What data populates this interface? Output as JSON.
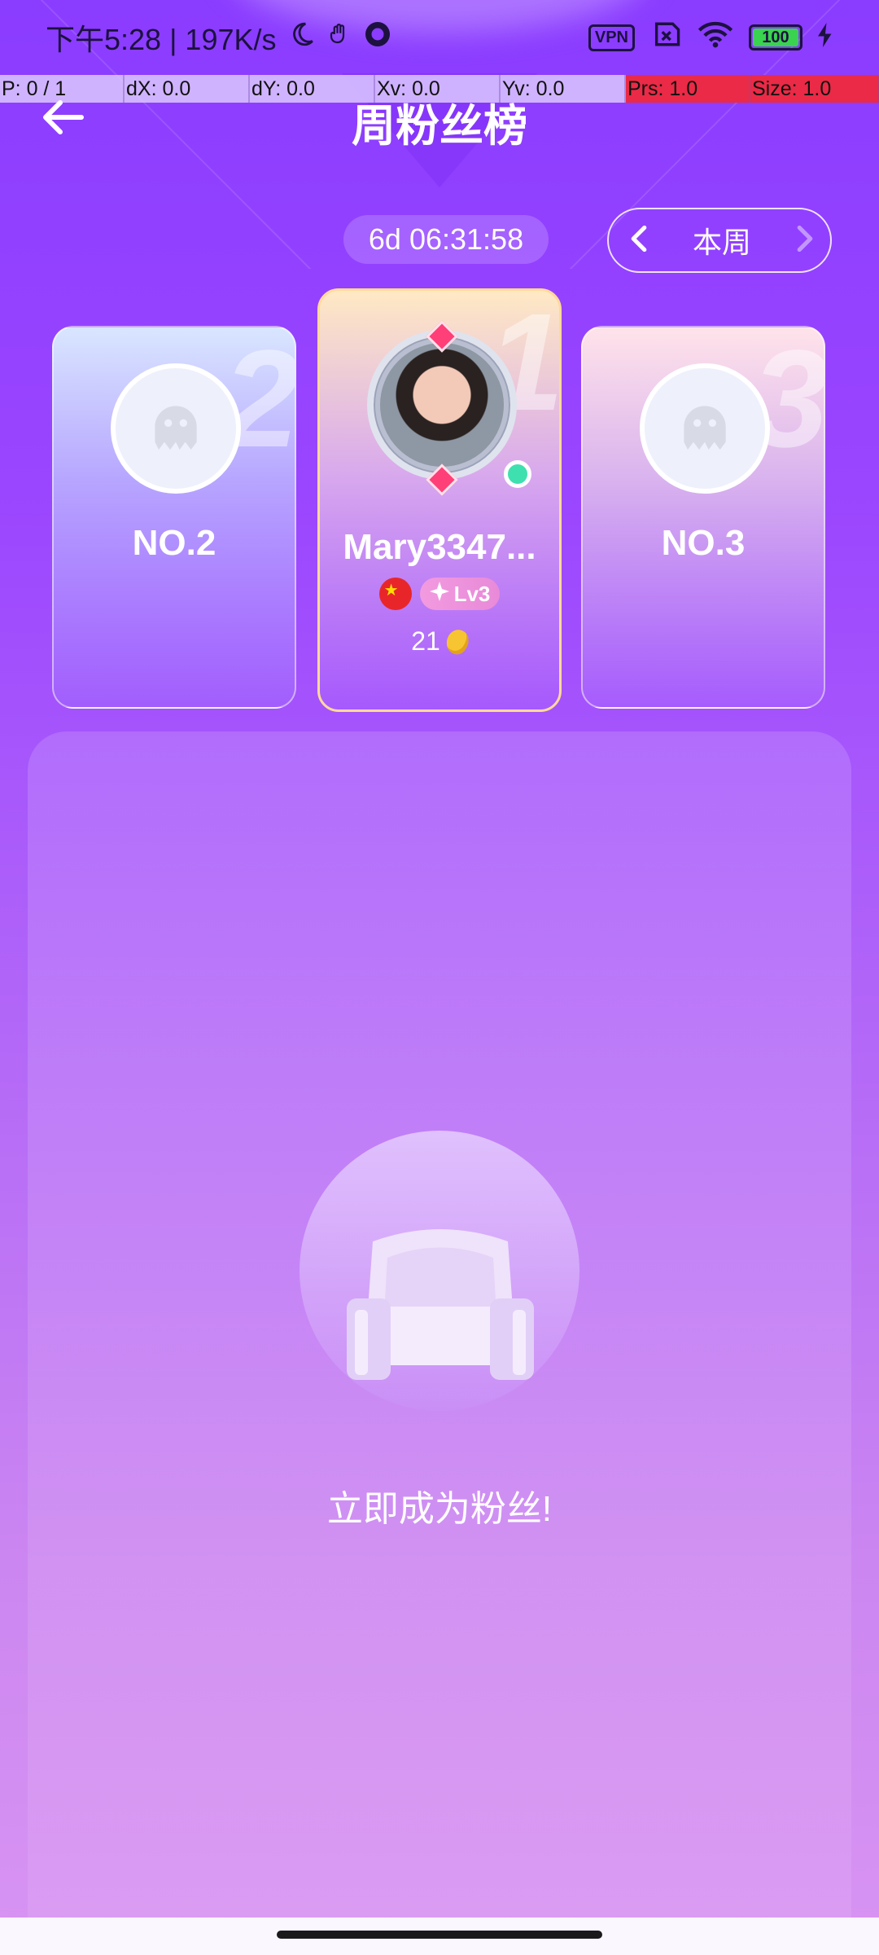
{
  "status_bar": {
    "time": "下午5:28 | 197K/s",
    "vpn_label": "VPN",
    "battery": "100",
    "icons": [
      "moon-icon",
      "hand-icon",
      "app-icon",
      "vpn-icon",
      "no-sim-icon",
      "wifi-icon",
      "battery-icon",
      "charging-icon"
    ]
  },
  "debug": {
    "p": "P: 0 / 1",
    "dx": "dX: 0.0",
    "dy": "dY: 0.0",
    "xv": "Xv: 0.0",
    "yv": "Yv: 0.0",
    "prs": "Prs: 1.0",
    "size": "Size: 1.0"
  },
  "header": {
    "title": "周粉丝榜"
  },
  "countdown": "6d 06:31:58",
  "week_selector": {
    "label": "本周"
  },
  "podium": {
    "second": {
      "rank": "2",
      "label": "NO.2"
    },
    "first": {
      "rank": "1",
      "name": "Mary3347...",
      "level": "Lv3",
      "score": "21"
    },
    "third": {
      "rank": "3",
      "label": "NO.3"
    }
  },
  "empty_state": {
    "text": "立即成为粉丝!"
  },
  "colors": {
    "bg_top": "#8a3cff",
    "bg_bottom": "#d894f2",
    "online": "#3fe0b0",
    "accent_gold": "#ffd99a"
  }
}
